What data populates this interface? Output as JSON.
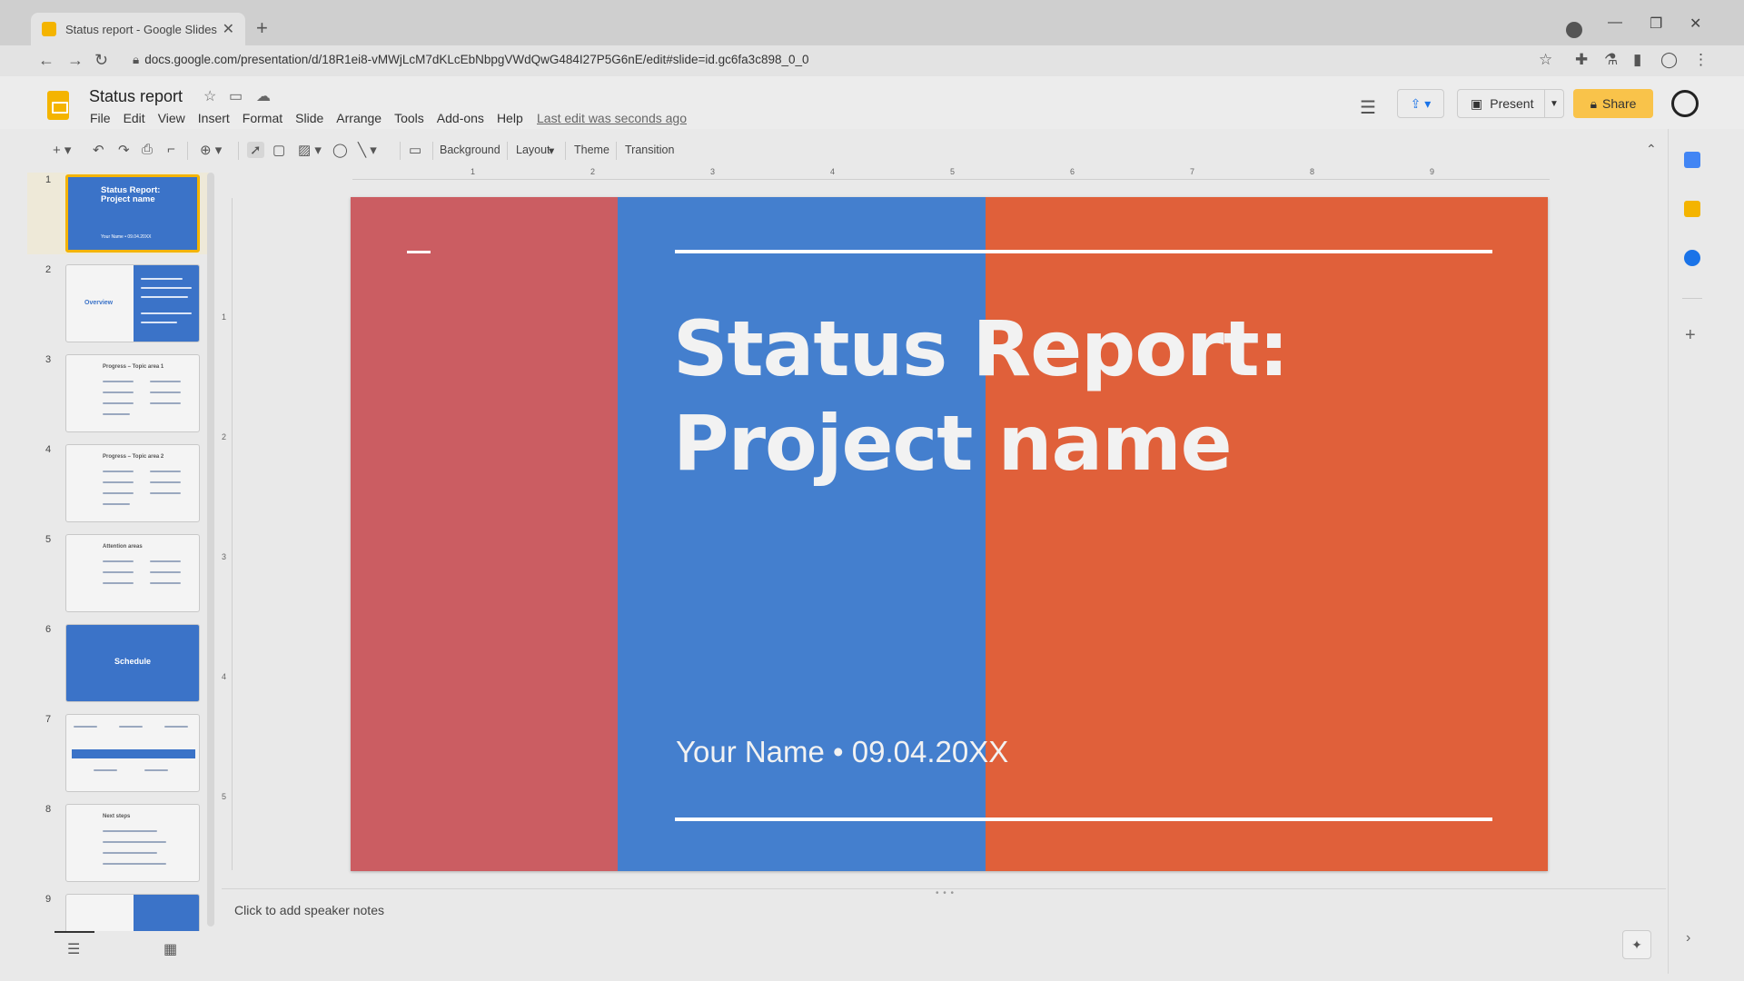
{
  "browser": {
    "tab_title": "Status report - Google Slides",
    "url": "docs.google.com/presentation/d/18R1ei8-vMWjLcM7dKLcEbNbpgVWdQwG484I27P5G6nE/edit#slide=id.gc6fa3c898_0_0"
  },
  "app": {
    "doc_title": "Status report",
    "menu": [
      "File",
      "Edit",
      "View",
      "Insert",
      "Format",
      "Slide",
      "Arrange",
      "Tools",
      "Add-ons",
      "Help"
    ],
    "last_edit": "Last edit was seconds ago",
    "present_label": "Present",
    "share_label": "Share"
  },
  "toolbar": {
    "background": "Background",
    "layout": "Layout",
    "theme": "Theme",
    "transition": "Transition"
  },
  "ruler": {
    "h": [
      "1",
      "2",
      "3",
      "4",
      "5",
      "6",
      "7",
      "8",
      "9"
    ],
    "v": [
      "1",
      "2",
      "3",
      "4",
      "5"
    ]
  },
  "thumbnails": [
    {
      "num": "1",
      "title": "Status Report: Project name",
      "sub": "Your Name • 09.04.20XX"
    },
    {
      "num": "2",
      "title": "Overview"
    },
    {
      "num": "3",
      "title": "Progress – Topic area 1"
    },
    {
      "num": "4",
      "title": "Progress – Topic area 2"
    },
    {
      "num": "5",
      "title": "Attention areas"
    },
    {
      "num": "6",
      "title": "Schedule"
    },
    {
      "num": "7",
      "title": ""
    },
    {
      "num": "8",
      "title": "Next steps"
    },
    {
      "num": "9",
      "title": ""
    }
  ],
  "slide": {
    "title_line1": "Status Report:",
    "title_line2": "Project name",
    "subtitle": "Your Name • 09.04.20XX",
    "colors": {
      "red": "#cb5d62",
      "blue": "#447fce",
      "orange": "#e0603a"
    }
  },
  "notes_placeholder": "Click to add speaker notes",
  "colors": {
    "accent": "#f4b400",
    "share": "#f9c34a"
  }
}
